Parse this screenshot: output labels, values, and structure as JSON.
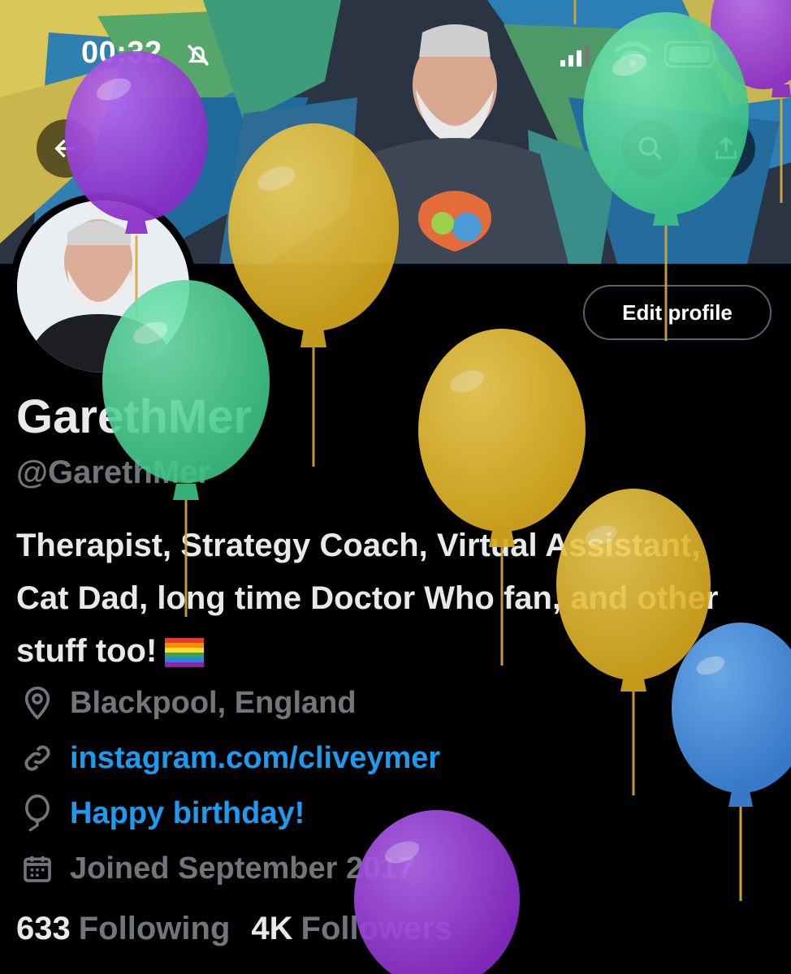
{
  "status_bar": {
    "time": "00:32",
    "icons": [
      "bell-slash-icon",
      "signal-icon",
      "wifi-icon",
      "battery-icon"
    ]
  },
  "nav": {
    "back_icon": "arrow-left-icon",
    "search_icon": "search-icon",
    "share_icon": "share-icon"
  },
  "profile": {
    "edit_button_label": "Edit profile",
    "display_name": "GarethMer",
    "handle": "@GarethMer",
    "bio": "Therapist, Strategy Coach, Virtual Assistant, Cat Dad, long time Doctor Who fan, and other stuff too!",
    "bio_emoji": "rainbow-flag",
    "location": "Blackpool, England",
    "link": "instagram.com/cliveymer",
    "birthday": "Happy birthday!",
    "joined": "Joined September 2017"
  },
  "stats": {
    "following_count": "633",
    "following_label": "Following",
    "followers_count": "4K",
    "followers_label": "Followers"
  },
  "colors": {
    "background": "#000000",
    "text_primary": "#e7e9ea",
    "text_secondary": "#71767b",
    "link_blue": "#1d9bf0",
    "balloon_purple": "#9b3fd6",
    "balloon_yellow": "#e6bd2e",
    "balloon_green": "#4fd69a",
    "balloon_blue": "#4a90e2"
  }
}
